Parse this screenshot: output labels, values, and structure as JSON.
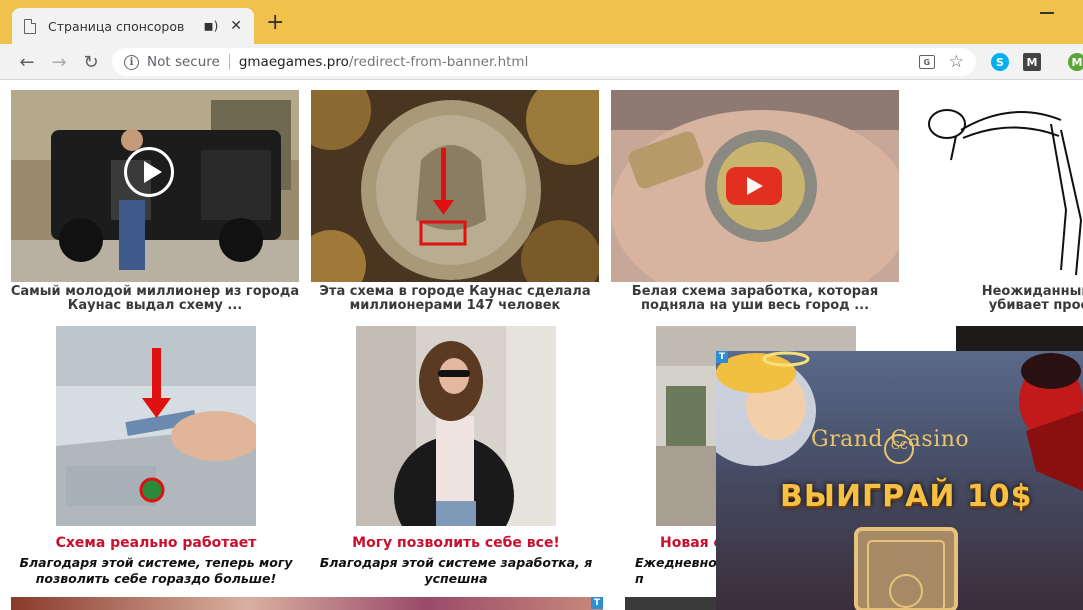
{
  "browser": {
    "tab_title": "Страница спонсоров",
    "tab_close": "✕",
    "new_tab": "+",
    "security_label": "Not secure",
    "url_host": "gmaegames.pro",
    "url_path": "/redirect-from-banner.html",
    "extension_skype": "S",
    "extension_gmail": "M",
    "profile_initial": "M"
  },
  "row1": [
    {
      "caption_line1": "Самый молодой миллионер из города",
      "caption_line2": "Каунас выдал схему ..."
    },
    {
      "caption_line1": "Эта схема в городе Каунас сделала",
      "caption_line2": "миллионерами 147 человек"
    },
    {
      "caption_line1": "Белая схема заработка, которая",
      "caption_line2": "подняла на уши весь город ..."
    },
    {
      "caption_line1": "Неожиданный спос",
      "caption_line2": "убивает простати"
    }
  ],
  "row2": [
    {
      "title": "Схема реально работает",
      "desc_line1": "Благодаря этой системе, теперь могу",
      "desc_line2": "позволить себе гораздо больше!"
    },
    {
      "title": "Могу позволить себе все!",
      "desc_line1": "Благодаря этой системе заработка, я",
      "desc_line2": "успешна"
    },
    {
      "title": "Новая с",
      "desc_line1": "Ежедневно п",
      "desc_line2": ""
    }
  ],
  "casino_ad": {
    "logo": "Grand  Casino",
    "monogram": "GC",
    "headline": "ВЫИГРАЙ 10$",
    "ad_marker": "T"
  },
  "colors": {
    "titlebar": "#f0c14b",
    "accent_red": "#c8102e"
  }
}
